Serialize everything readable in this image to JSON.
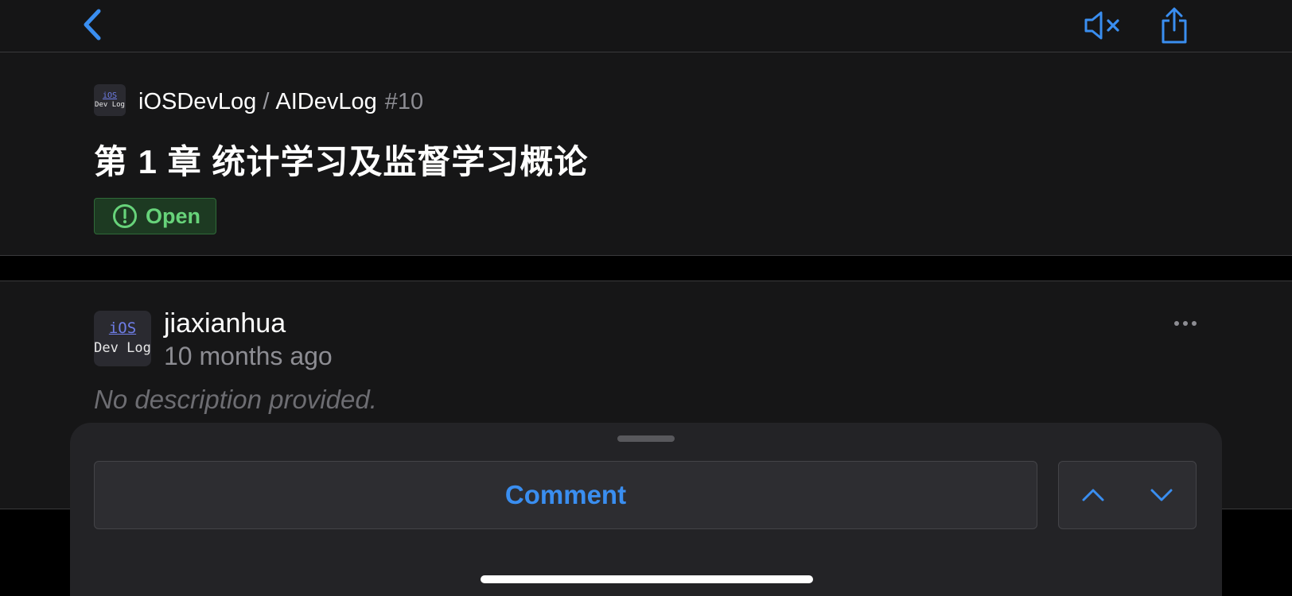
{
  "colors": {
    "accent": "#3a8ef0",
    "background": "#000000",
    "surface": "#161617",
    "open_badge_bg": "#1d3a22",
    "open_badge_text": "#67d37a",
    "secondary_text": "#8d8d93"
  },
  "navbar": {
    "back_icon": "chevron-left-icon",
    "mute_icon": "speaker-muted-icon",
    "share_icon": "share-icon"
  },
  "issue": {
    "repo_avatar": {
      "line1": "iOS",
      "line2": "Dev Log"
    },
    "owner": "iOSDevLog",
    "separator": "/",
    "repo": "AIDevLog",
    "number": "#10",
    "title": "第 1 章 统计学习及监督学习概论",
    "status": "Open",
    "status_icon": "exclamation-circle-icon"
  },
  "comment": {
    "avatar": {
      "line1": "iOS",
      "line2": "Dev Log"
    },
    "author": "jiaxianhua",
    "time": "10 months ago",
    "body": "No description provided.",
    "more_icon": "ellipsis-icon"
  },
  "sheet": {
    "comment_label": "Comment",
    "prev_icon": "chevron-up-icon",
    "next_icon": "chevron-down-icon"
  }
}
